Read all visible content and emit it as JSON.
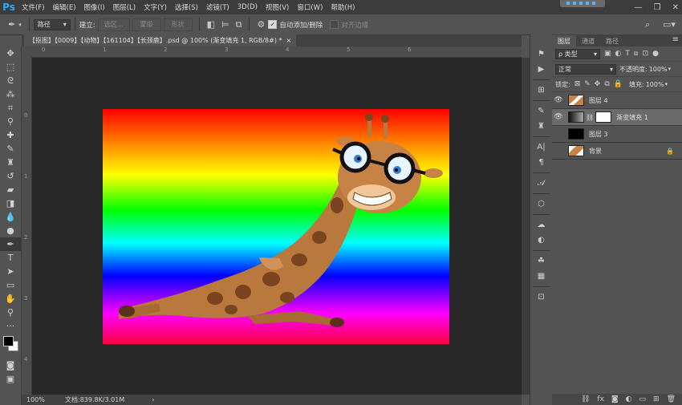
{
  "app": {
    "logo": "Ps"
  },
  "menu": [
    "文件(F)",
    "编辑(E)",
    "图像(I)",
    "图层(L)",
    "文字(Y)",
    "选择(S)",
    "滤镜(T)",
    "3D(D)",
    "视图(V)",
    "窗口(W)",
    "帮助(H)"
  ],
  "options": {
    "mode_select": "路径",
    "make_label": "建立:",
    "btn_selection": "选区...",
    "btn_mask": "蒙版",
    "btn_shape": "形状",
    "auto_add_label": "自动添加/删除",
    "align_edges_label": "对齐边缘"
  },
  "document": {
    "tab_title": "【抠图】【0009】【动物】【161104】【长颈鹿】.psd @ 100% (渐变填充 1, RGB/8#) *",
    "close_glyph": "×",
    "zoom": "100%",
    "doc_info": "文档:839.8K/3.01M"
  },
  "ruler": {
    "h_numbers": [
      "0",
      "1",
      "2",
      "3",
      "4",
      "5",
      "6"
    ],
    "v_numbers": [
      "0",
      "1",
      "2",
      "3",
      "4"
    ]
  },
  "layers_panel": {
    "tabs": [
      "图层",
      "通道",
      "路径"
    ],
    "filter_select": "ρ 类型",
    "blend_mode": "正常",
    "opacity_label": "不透明度:",
    "opacity_value": "100%",
    "lock_label": "锁定:",
    "fill_label": "填充:",
    "fill_value": "100%",
    "layers": [
      {
        "name": "图层 4",
        "visible": true,
        "selected": false
      },
      {
        "name": "渐变填充 1",
        "visible": true,
        "selected": true
      },
      {
        "name": "图层 3",
        "visible": false,
        "selected": false
      },
      {
        "name": "背景",
        "visible": false,
        "selected": false
      }
    ]
  },
  "colors": {
    "foreground": "#000000",
    "background": "#ffffff",
    "accent": "#2fa8ff"
  }
}
